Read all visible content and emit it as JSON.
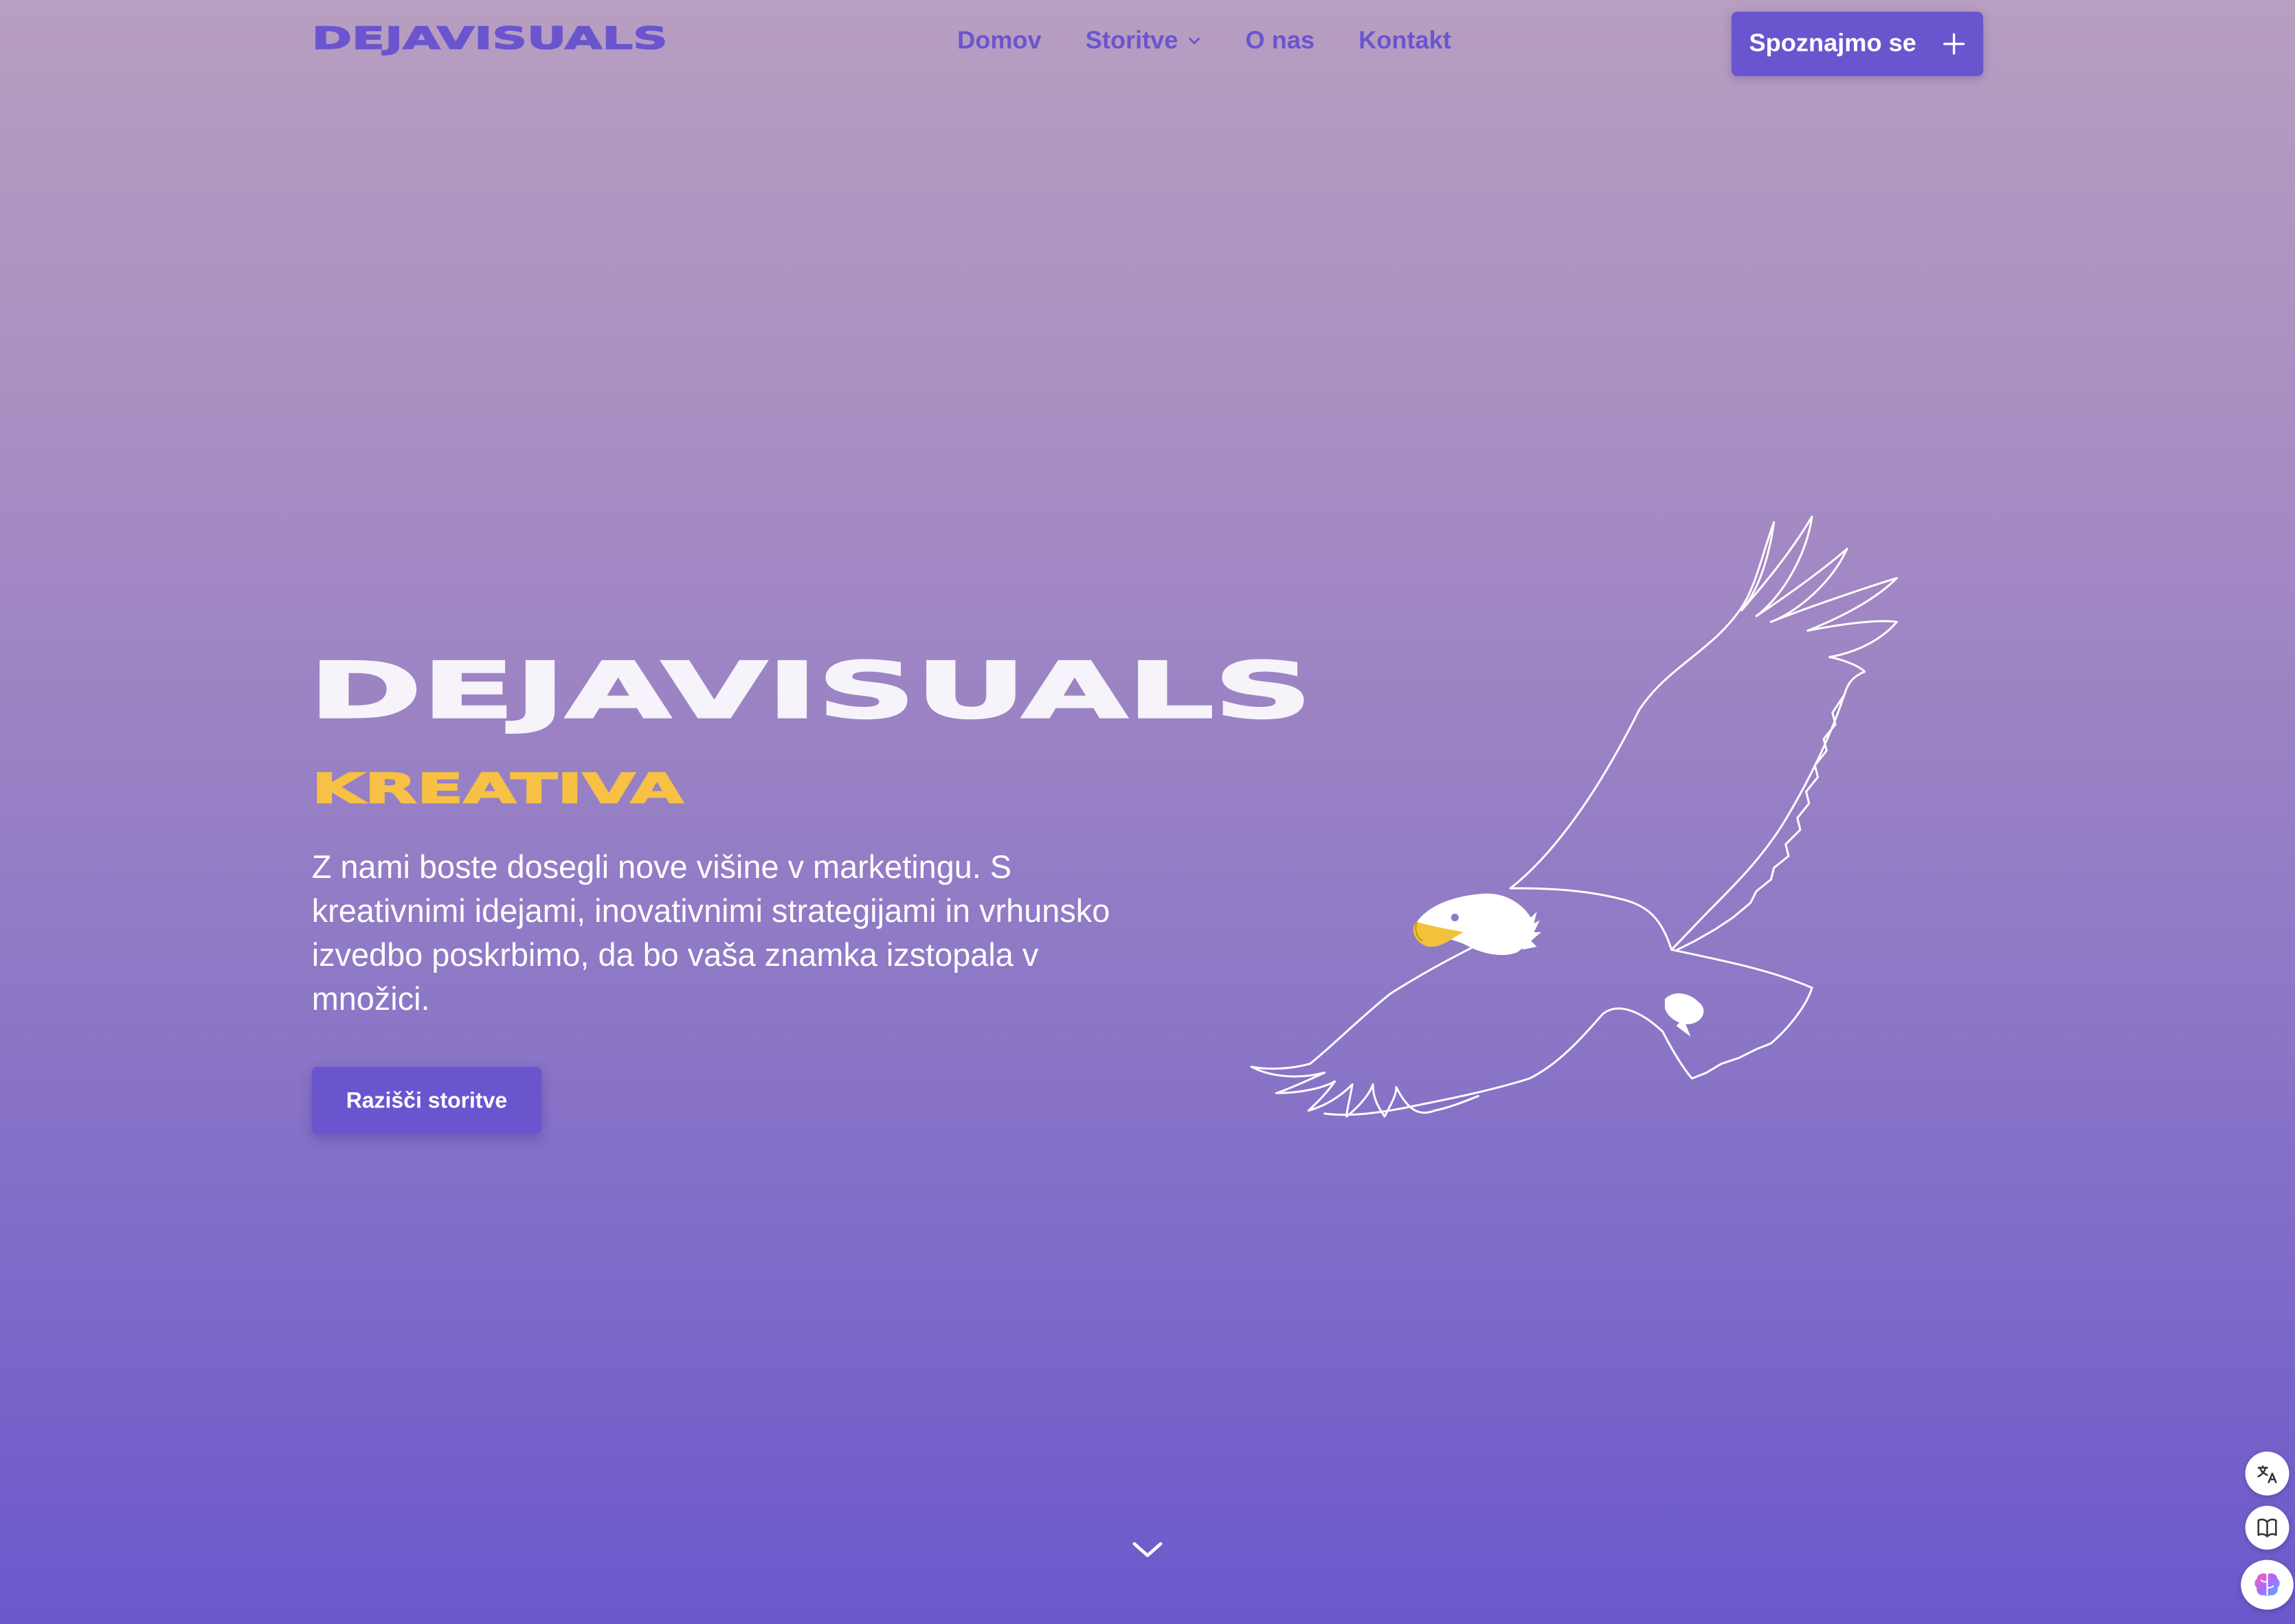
{
  "header": {
    "logo": "DEJAVISUALS",
    "nav": [
      {
        "label": "Domov"
      },
      {
        "label": "Storitve"
      },
      {
        "label": "O nas"
      },
      {
        "label": "Kontakt"
      }
    ],
    "cta_label": "Spoznajmo se"
  },
  "hero": {
    "title": "DEJAVISUALS",
    "subtitle": "KREATIVA",
    "text": "Z nami boste dosegli nove višine v marketingu. S kreativnimi idejami, inovativnimi strategijami in vrhunsko izvedbo poskrbimo, da bo vaša znamka izstopala v množici.",
    "button_label": "Razišči storitve"
  },
  "colors": {
    "accent": "#6a55cf",
    "highlight": "#f6c145",
    "text_light": "#ffffff"
  },
  "icons": {
    "nav_dropdown": "chevron-down-icon",
    "cta": "plus-icon",
    "scroll": "chevron-down-icon",
    "tools": [
      "translate-icon",
      "book-icon",
      "brain-icon"
    ]
  }
}
